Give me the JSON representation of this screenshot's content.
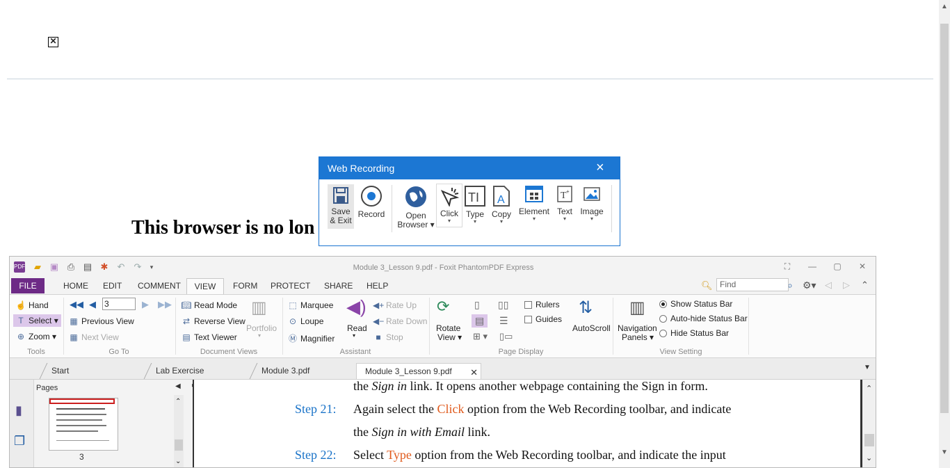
{
  "background_page": {
    "close_glyph": "✕",
    "heading": "This browser is no lon"
  },
  "foxit": {
    "window_title": "Module 3_Lesson 9.pdf - Foxit PhantomPDF Express",
    "menu": [
      "FILE",
      "HOME",
      "EDIT",
      "COMMENT",
      "VIEW",
      "FORM",
      "PROTECT",
      "SHARE",
      "HELP"
    ],
    "active_menu": "VIEW",
    "find_placeholder": "Find",
    "ribbon": {
      "tools": {
        "hand": "Hand",
        "select": "Select",
        "zoom": "Zoom",
        "group": "Tools"
      },
      "goto": {
        "page_value": "3",
        "previous_view": "Previous View",
        "next_view": "Next View",
        "group": "Go To"
      },
      "document_views": {
        "read_mode": "Read Mode",
        "reverse_view": "Reverse View",
        "text_viewer": "Text Viewer",
        "portfolio": "Portfolio",
        "group": "Document Views"
      },
      "assistant": {
        "marquee": "Marquee",
        "loupe": "Loupe",
        "magnifier": "Magnifier",
        "read": "Read",
        "rate_up": "Rate Up",
        "rate_down": "Rate Down",
        "stop": "Stop",
        "group": "Assistant"
      },
      "page_display": {
        "rotate_view_1": "Rotate",
        "rotate_view_2": "View",
        "rulers": "Rulers",
        "guides": "Guides",
        "autoscroll": "AutoScroll",
        "group": "Page Display"
      },
      "view_setting": {
        "nav_panels_1": "Navigation",
        "nav_panels_2": "Panels",
        "show_status": "Show Status Bar",
        "autohide_status": "Auto-hide Status Bar",
        "hide_status": "Hide Status Bar",
        "group": "View Setting"
      }
    },
    "tabs": [
      "Start",
      "Lab Exercise Manual_Pa...",
      "Module 3.pdf",
      "Module 3_Lesson 9.pdf"
    ],
    "active_tab": "Module 3_Lesson 9.pdf",
    "panel": {
      "title": "Pages",
      "page_number": "3"
    },
    "document": {
      "line1_a": "the ",
      "line1_b": "Sign in",
      "line1_c": " link. It opens another webpage containing the Sign in form.",
      "step21_label": "Step 21:",
      "step21_a": "Again select the ",
      "step21_b": "Click",
      "step21_c": " option from the Web Recording toolbar, and indicate",
      "step21_line2_a": "the ",
      "step21_line2_b": "Sign in with Email",
      "step21_line2_c": " link.",
      "step22_label": "Step 22:",
      "step22_a": "Select ",
      "step22_b": "Type",
      "step22_c": " option from the Web Recording toolbar, and indicate the input"
    }
  },
  "web_recording": {
    "title": "Web Recording",
    "buttons": [
      {
        "name": "save-exit",
        "label_1": "Save",
        "label_2": "& Exit"
      },
      {
        "name": "record",
        "label_1": "Record"
      },
      {
        "name": "open-browser",
        "label_1": "Open",
        "label_2": "Browser"
      },
      {
        "name": "click",
        "label_1": "Click"
      },
      {
        "name": "type",
        "label_1": "Type"
      },
      {
        "name": "copy",
        "label_1": "Copy"
      },
      {
        "name": "element",
        "label_1": "Element"
      },
      {
        "name": "text",
        "label_1": "Text"
      },
      {
        "name": "image",
        "label_1": "Image"
      }
    ]
  },
  "colors": {
    "accent": "#1c77d3",
    "file_tab": "#6d2a86",
    "step_blue": "#1a73c8",
    "highlight_red": "#e05a1c"
  }
}
